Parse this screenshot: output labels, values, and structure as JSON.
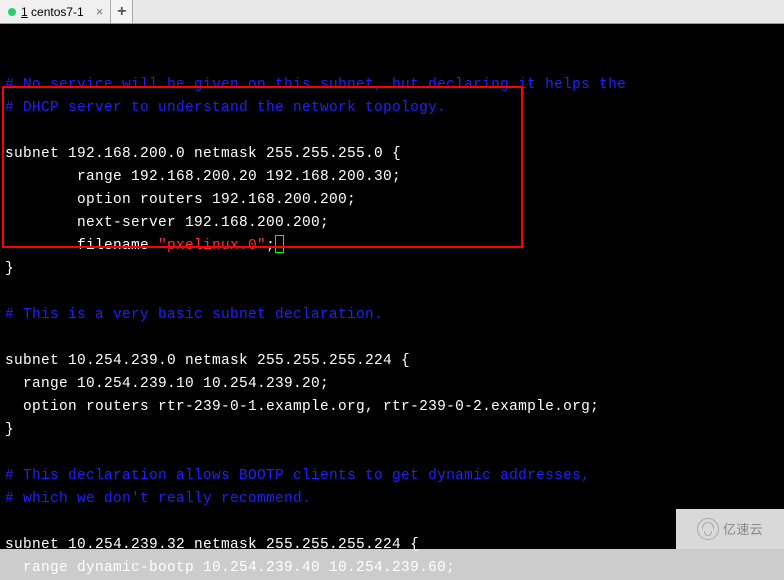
{
  "tab": {
    "index": "1",
    "title": "centos7-1",
    "close": "×",
    "new": "+"
  },
  "code": {
    "c1": "# No service will be given on this subnet, but declaring it helps the",
    "c2": "# DHCP server to understand the network topology.",
    "blank": "",
    "l1": "subnet 192.168.200.0 netmask 255.255.255.0 {",
    "l2": "        range 192.168.200.20 192.168.200.30;",
    "l3": "        option routers 192.168.200.200;",
    "l4": "        next-server 192.168.200.200;",
    "l5a": "        filename ",
    "l5b": "\"pxelinux.0\"",
    "l5c": ";",
    "l6": "}",
    "c3": "# This is a very basic subnet declaration.",
    "l7": "subnet 10.254.239.0 netmask 255.255.255.224 {",
    "l8": "  range 10.254.239.10 10.254.239.20;",
    "l9": "  option routers rtr-239-0-1.example.org, rtr-239-0-2.example.org;",
    "l10": "}",
    "c4": "# This declaration allows BOOTP clients to get dynamic addresses,",
    "c5": "# which we don't really recommend.",
    "l11": "subnet 10.254.239.32 netmask 255.255.255.224 {",
    "l12": "  range dynamic-bootp 10.254.239.40 10.254.239.60;"
  },
  "watermark": {
    "text": "亿速云"
  }
}
